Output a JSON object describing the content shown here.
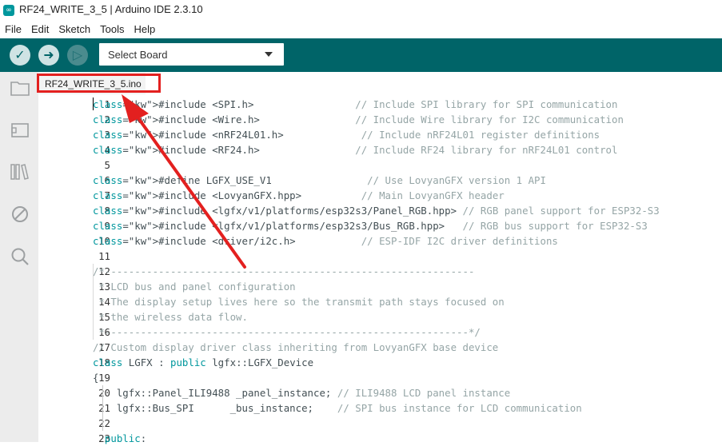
{
  "window": {
    "title": "RF24_WRITE_3_5 | Arduino IDE 2.3.10",
    "logo": "∞"
  },
  "menu": [
    "File",
    "Edit",
    "Sketch",
    "Tools",
    "Help"
  ],
  "toolbar": {
    "verify_icon": "✓",
    "upload_icon": "➜",
    "debug_icon": "▷",
    "board_select": "Select Board"
  },
  "sidebar": [
    {
      "icon": "folder-icon",
      "glyph": "🗀"
    },
    {
      "icon": "board-manager-icon",
      "glyph": "▭"
    },
    {
      "icon": "library-icon",
      "glyph": "▥"
    },
    {
      "icon": "debug-icon",
      "glyph": "⊘"
    },
    {
      "icon": "search-icon",
      "glyph": "⚲"
    }
  ],
  "tab": {
    "label": "RF24_WRITE_3_5.ino"
  },
  "annotation_color": "#e3201f",
  "code_lines": [
    {
      "n": "1",
      "t": "#include <SPI.h>                 // Include SPI library for SPI communication"
    },
    {
      "n": "2",
      "t": "#include <Wire.h>                // Include Wire library for I2C communication"
    },
    {
      "n": "3",
      "t": "#include <nRF24L01.h>             // Include nRF24L01 register definitions"
    },
    {
      "n": "4",
      "t": "#include <RF24.h>                // Include RF24 library for nRF24L01 control"
    },
    {
      "n": "5",
      "t": ""
    },
    {
      "n": "6",
      "t": "#define LGFX_USE_V1                // Use LovyanGFX version 1 API"
    },
    {
      "n": "7",
      "t": "#include <LovyanGFX.hpp>          // Main LovyanGFX header"
    },
    {
      "n": "8",
      "t": "#include <lgfx/v1/platforms/esp32s3/Panel_RGB.hpp> // RGB panel support for ESP32-S3"
    },
    {
      "n": "9",
      "t": "#include <lgfx/v1/platforms/esp32s3/Bus_RGB.hpp>   // RGB bus support for ESP32-S3"
    },
    {
      "n": "10",
      "t": "#include <driver/i2c.h>           // ESP-IDF I2C driver definitions"
    },
    {
      "n": "11",
      "t": ""
    },
    {
      "n": "12",
      "t": "/*--------------------------------------------------------------"
    },
    {
      "n": "13",
      "t": " * LCD bus and panel configuration"
    },
    {
      "n": "14",
      "t": " * The display setup lives here so the transmit path stays focused on"
    },
    {
      "n": "15",
      "t": " * the wireless data flow."
    },
    {
      "n": "16",
      "t": " *-------------------------------------------------------------*/"
    },
    {
      "n": "17",
      "t": "// Custom display driver class inheriting from LovyanGFX base device"
    },
    {
      "n": "18",
      "t": "class LGFX : public lgfx::LGFX_Device"
    },
    {
      "n": "19",
      "t": "{"
    },
    {
      "n": "20",
      "t": "    lgfx::Panel_ILI9488 _panel_instance; // ILI9488 LCD panel instance"
    },
    {
      "n": "21",
      "t": "    lgfx::Bus_SPI      _bus_instance;    // SPI bus instance for LCD communication"
    },
    {
      "n": "22",
      "t": ""
    },
    {
      "n": "23",
      "t": "  public:"
    }
  ]
}
